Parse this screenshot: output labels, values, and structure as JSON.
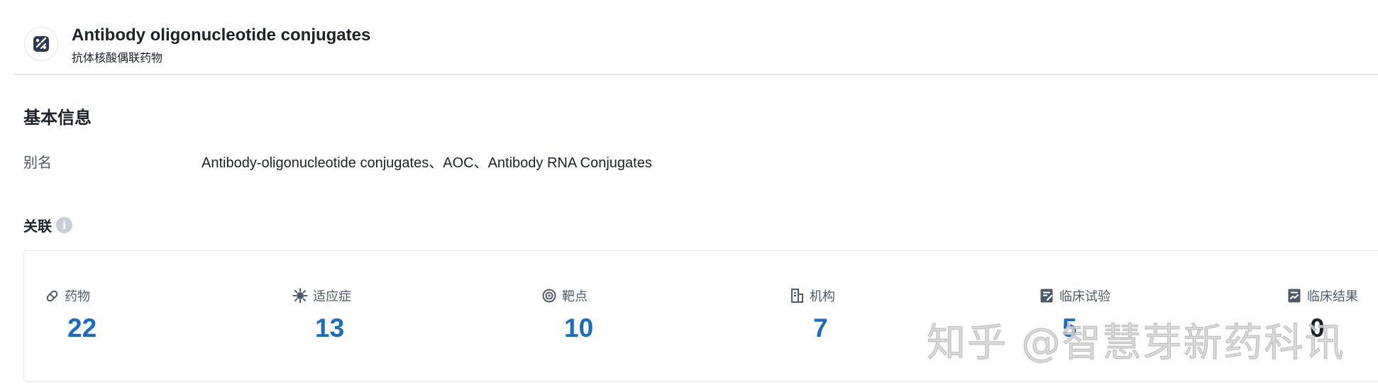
{
  "header": {
    "icon": "conjugate-icon",
    "title": "Antibody oligonucleotide conjugates",
    "subtitle": "抗体核酸偶联药物"
  },
  "basic_info": {
    "section_title": "基本信息",
    "alias_label": "别名",
    "alias_value": "Antibody-oligonucleotide conjugates、AOC、Antibody RNA Conjugates"
  },
  "related": {
    "title": "关联",
    "info_icon": "info-icon",
    "stats": [
      {
        "icon": "pill-icon",
        "label": "药物",
        "value": "22"
      },
      {
        "icon": "virus-icon",
        "label": "适应症",
        "value": "13"
      },
      {
        "icon": "target-icon",
        "label": "靶点",
        "value": "10"
      },
      {
        "icon": "building-icon",
        "label": "机构",
        "value": "7"
      },
      {
        "icon": "clinical-trial-icon",
        "label": "临床试验",
        "value": "5"
      },
      {
        "icon": "clinical-result-icon",
        "label": "临床结果",
        "value": "0"
      }
    ]
  },
  "watermark": "知乎 @智慧芽新药科讯",
  "colors": {
    "accent": "#1a6bc4",
    "border": "#e5e6eb",
    "label": "#4e5969"
  }
}
